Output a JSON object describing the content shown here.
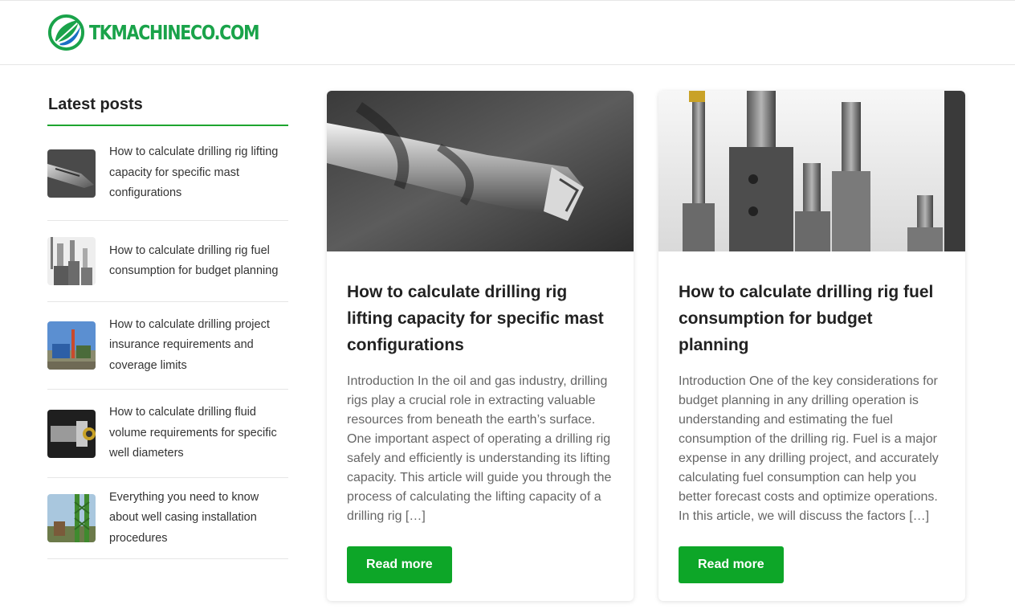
{
  "header": {
    "logo_text": "TKMACHINECO.COM",
    "logo_icon": "green-blue-leaf-circle-icon",
    "brand_color": "#1aa34a"
  },
  "sidebar": {
    "title": "Latest posts",
    "posts": [
      {
        "title": "How to calculate drilling rig lifting capacity for specific mast configurations",
        "thumb": "drill-bit-thumbnail"
      },
      {
        "title": "How to calculate drilling rig fuel consumption for budget planning",
        "thumb": "end-mill-tools-thumbnail"
      },
      {
        "title": "How to calculate drilling project insurance requirements and coverage limits",
        "thumb": "drilling-site-thumbnail"
      },
      {
        "title": "How to calculate drilling fluid volume requirements for specific well diameters",
        "thumb": "tool-holder-thumbnail"
      },
      {
        "title": "Everything you need to know about well casing installation procedures",
        "thumb": "rig-structure-thumbnail"
      }
    ]
  },
  "cards": [
    {
      "title": "How to calculate drilling rig lifting capacity for specific mast configurations",
      "excerpt": "Introduction In the oil and gas industry, drilling rigs play a crucial role in extracting valuable resources from beneath the earth’s surface. One important aspect of operating a drilling rig safely and efficiently is understanding its lifting capacity. This article will guide you through the process of calculating the lifting capacity of a drilling rig […]",
      "button": "Read more"
    },
    {
      "title": "How to calculate drilling rig fuel consumption for budget planning",
      "excerpt": "Introduction One of the key considerations for budget planning in any drilling operation is understanding and estimating the fuel consumption of the drilling rig. Fuel is a major expense in any drilling project, and accurately calculating fuel consumption can help you better forecast costs and optimize operations. In this article, we will discuss the factors […]",
      "button": "Read more"
    }
  ],
  "colors": {
    "accent": "#0da628",
    "sidebar_underline": "#1ea52f",
    "text_dark": "#222222",
    "text_muted": "#666666"
  }
}
